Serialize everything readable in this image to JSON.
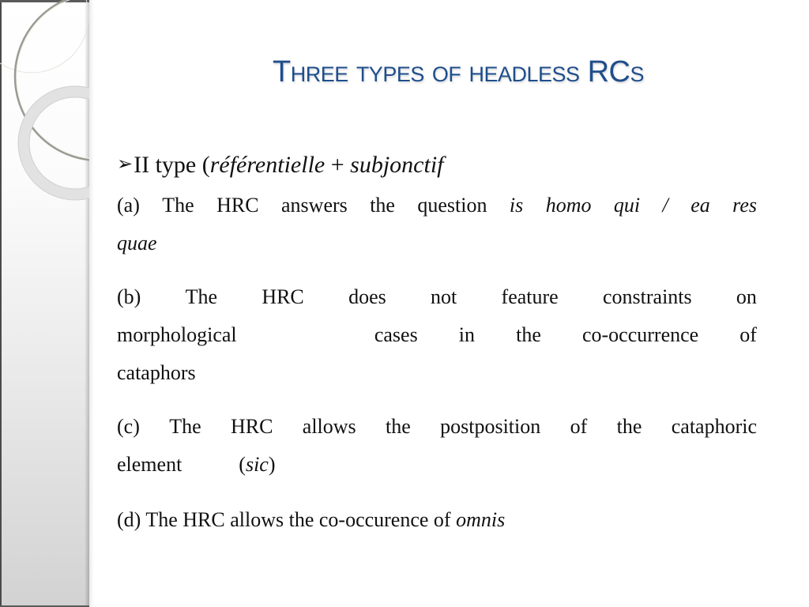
{
  "slide": {
    "title": "Three types of headless RCs",
    "bullet": {
      "icon": "arrow-bullet-icon",
      "label": "II type (",
      "italic_1": "référentielle",
      "plus": " + ",
      "italic_2": "subjonctif"
    },
    "points": {
      "a": {
        "words_line1": [
          "(a)",
          "The",
          "HRC",
          "answers",
          "the",
          "question"
        ],
        "italic_line1": [
          "is",
          "homo",
          "qui",
          "/",
          "ea",
          "res"
        ],
        "italic_line2": "quae"
      },
      "b": {
        "line1": [
          "(b)",
          "The",
          "HRC",
          "does",
          "not",
          "feature",
          "constraints",
          "on"
        ],
        "line2": [
          "morphological",
          "cases",
          "in",
          "the",
          "co-occurrence",
          "of"
        ],
        "line3": "cataphors"
      },
      "c": {
        "line1": [
          "(c)",
          "The",
          "HRC",
          "allows",
          "the",
          "postposition",
          "of",
          "the",
          "cataphoric"
        ],
        "line2_word": "element",
        "line2_open": "(",
        "line2_italic": "sic",
        "line2_close": ")"
      },
      "d": {
        "text": "(d) The HRC allows the co-occurence of ",
        "italic": "omnis"
      }
    }
  }
}
